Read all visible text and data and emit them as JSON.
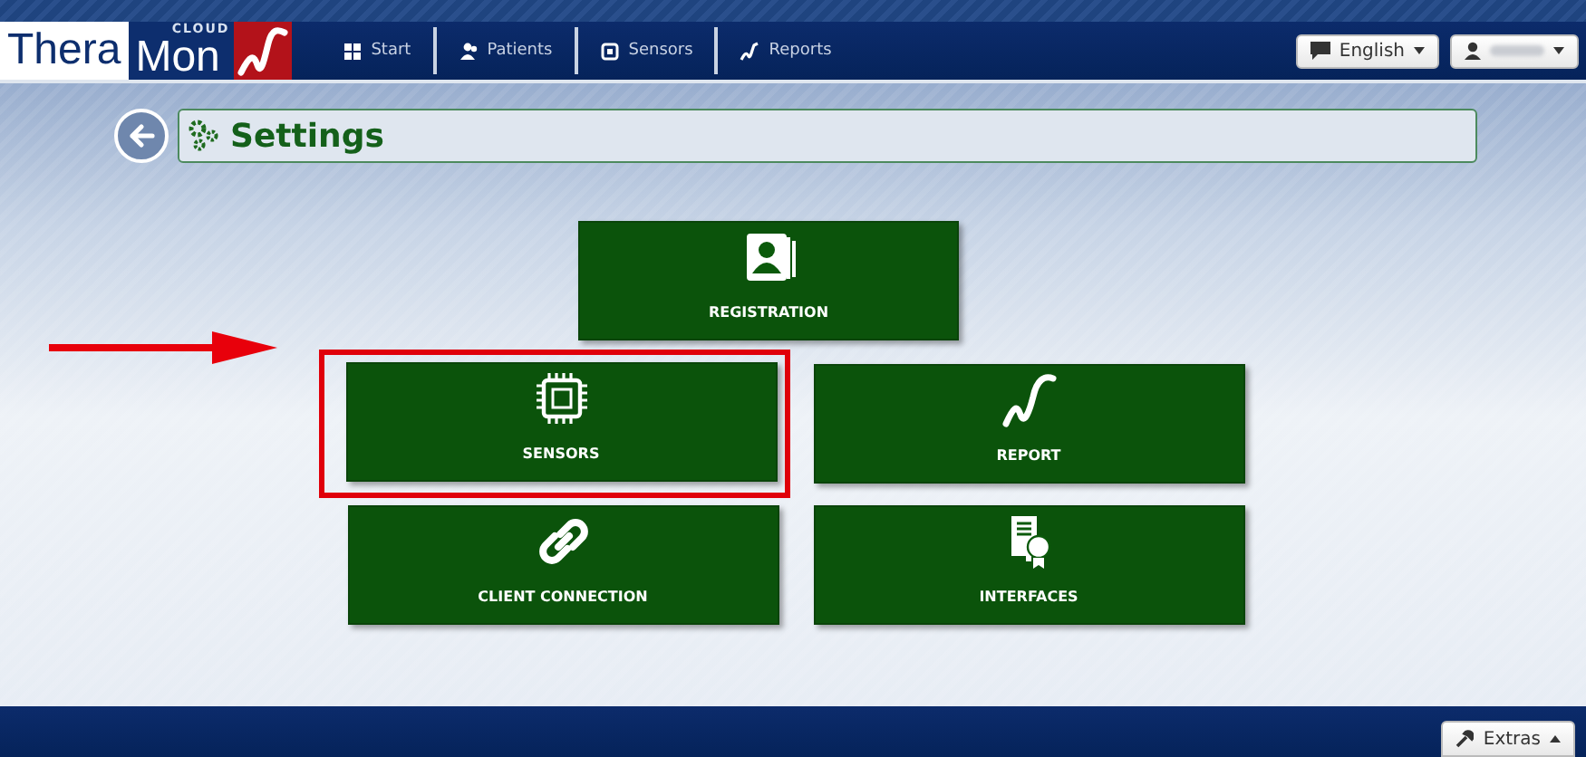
{
  "logo": {
    "left": "Thera",
    "right": "Mon",
    "badge": "CLOUD"
  },
  "nav": [
    {
      "label": "Start",
      "kind": "grid"
    },
    {
      "label": "Patients",
      "kind": "people"
    },
    {
      "label": "Sensors",
      "kind": "sensor"
    },
    {
      "label": "Reports",
      "kind": "curve"
    }
  ],
  "language": {
    "label": "English"
  },
  "page": {
    "title": "Settings"
  },
  "tiles": [
    {
      "label": "REGISTRATION",
      "kind": "card",
      "highlighted": false
    },
    {
      "label": "SENSORS",
      "kind": "chip",
      "highlighted": true
    },
    {
      "label": "REPORT",
      "kind": "curve",
      "highlighted": false
    },
    {
      "label": "CLIENT CONNECTION",
      "kind": "link",
      "highlighted": false
    },
    {
      "label": "INTERFACES",
      "kind": "certificate",
      "highlighted": false
    }
  ],
  "footer": {
    "extras": "Extras"
  }
}
